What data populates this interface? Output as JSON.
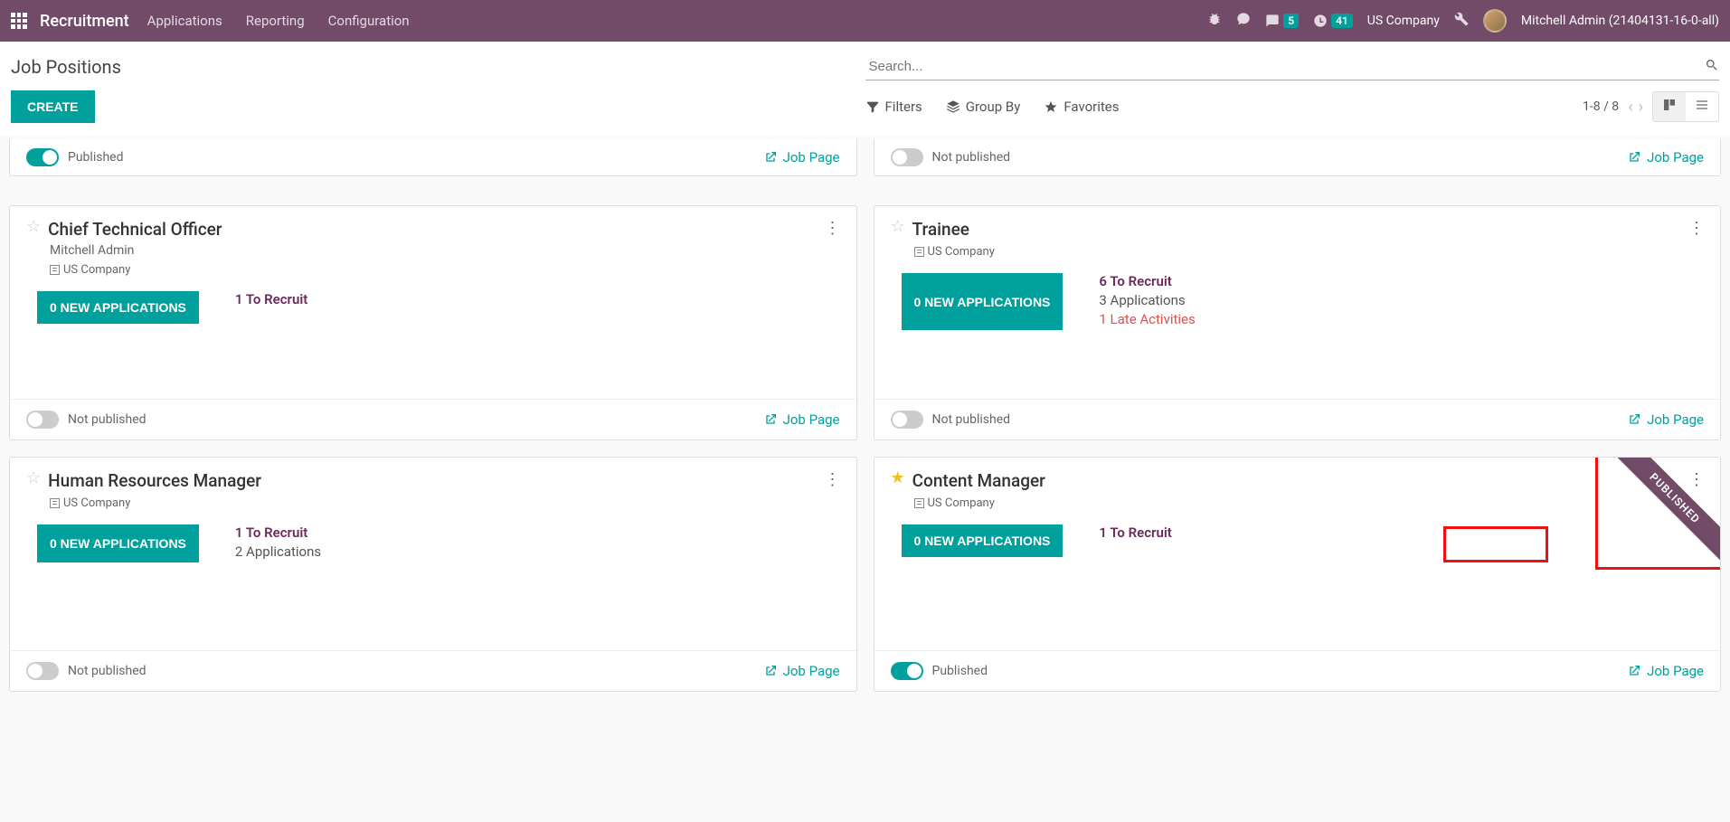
{
  "nav": {
    "brand": "Recruitment",
    "links": [
      "Applications",
      "Reporting",
      "Configuration"
    ],
    "msg_count": "5",
    "activity_count": "41",
    "company": "US Company",
    "user": "Mitchell Admin (21404131-16-0-all)"
  },
  "page": {
    "title": "Job Positions",
    "search_placeholder": "Search...",
    "create": "CREATE",
    "filters": "Filters",
    "groupby": "Group By",
    "favorites": "Favorites",
    "pager": "1-8 / 8"
  },
  "labels": {
    "published": "Published",
    "not_published": "Not published",
    "job_page": "Job Page",
    "new_apps": "NEW APPLICATIONS"
  },
  "partial_top": {
    "left": {
      "published": true,
      "label": "Published"
    },
    "right": {
      "published": false,
      "label": "Not published"
    }
  },
  "cards": [
    {
      "title": "Chief Technical Officer",
      "subtitle": "Mitchell Admin",
      "company": "US Company",
      "fav": false,
      "new_apps": "0",
      "stats": [
        {
          "text": "1 To Recruit",
          "type": "recruit"
        }
      ],
      "published": false,
      "ribbon": false
    },
    {
      "title": "Trainee",
      "subtitle": "",
      "company": "US Company",
      "fav": false,
      "new_apps": "0",
      "stats": [
        {
          "text": "6 To Recruit",
          "type": "recruit"
        },
        {
          "text": "3 Applications",
          "type": "plain"
        },
        {
          "text": "1 Late Activities",
          "type": "late"
        }
      ],
      "published": false,
      "ribbon": false
    },
    {
      "title": "Human Resources Manager",
      "subtitle": "",
      "company": "US Company",
      "fav": false,
      "new_apps": "0",
      "stats": [
        {
          "text": "1 To Recruit",
          "type": "recruit"
        },
        {
          "text": "2 Applications",
          "type": "plain"
        }
      ],
      "published": false,
      "ribbon": false
    },
    {
      "title": "Content Manager",
      "subtitle": "",
      "company": "US Company",
      "fav": true,
      "new_apps": "0",
      "stats": [
        {
          "text": "1 To Recruit",
          "type": "recruit"
        }
      ],
      "published": true,
      "ribbon": true,
      "ribbon_text": "PUBLISHED",
      "highlight": true
    }
  ]
}
